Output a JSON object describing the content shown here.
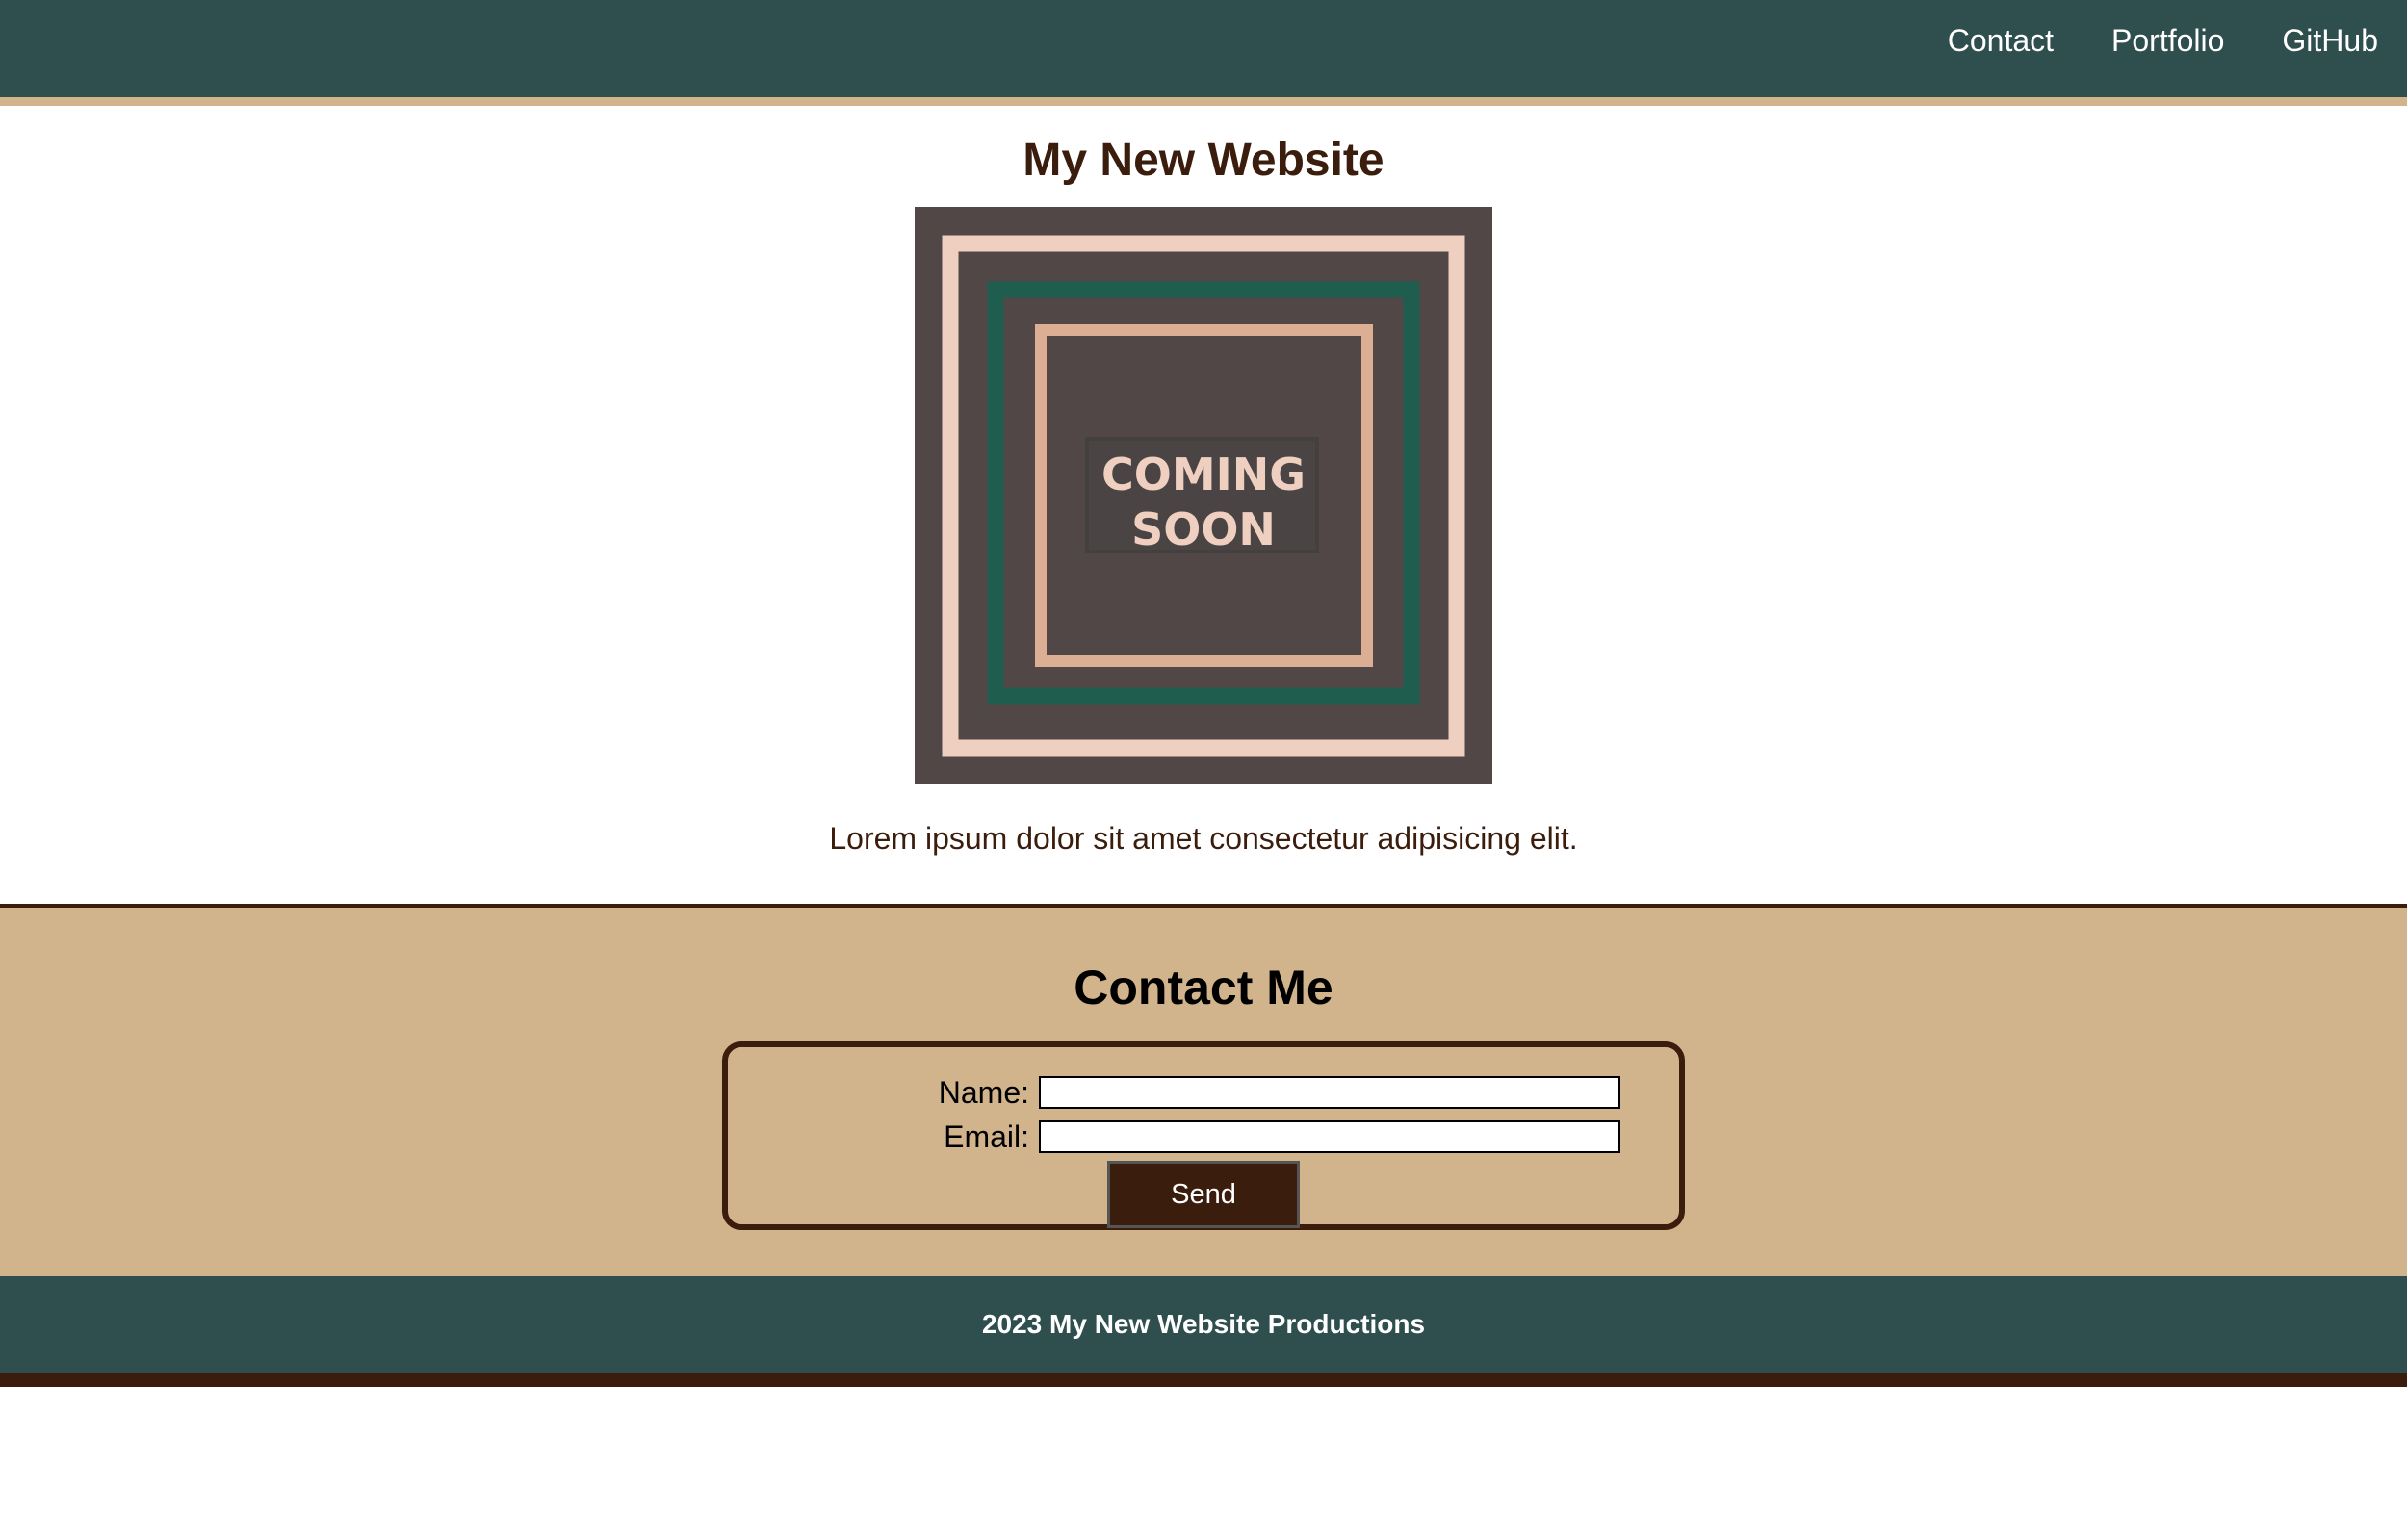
{
  "nav": {
    "items": [
      {
        "label": "Contact"
      },
      {
        "label": "Portfolio"
      },
      {
        "label": "GitHub"
      }
    ]
  },
  "hero": {
    "title": "My New Website",
    "image": {
      "line1": "COMING",
      "line2": "SOON"
    },
    "intro": "Lorem ipsum dolor sit amet consectetur adipisicing elit."
  },
  "contact": {
    "title": "Contact Me",
    "name_label": "Name:",
    "name_value": "",
    "email_label": "Email:",
    "email_value": "",
    "send_label": "Send"
  },
  "footer": {
    "text": "2023 My New Website Productions"
  },
  "colors": {
    "nav_background": "#2f4f4f",
    "accent_tan": "#d2b48c",
    "text_brown": "#3b1d0e",
    "image_background": "#524747",
    "image_frame_light": "#efcfbf",
    "image_frame_green": "#1f5e4f",
    "image_frame_peach": "#dcae93"
  }
}
